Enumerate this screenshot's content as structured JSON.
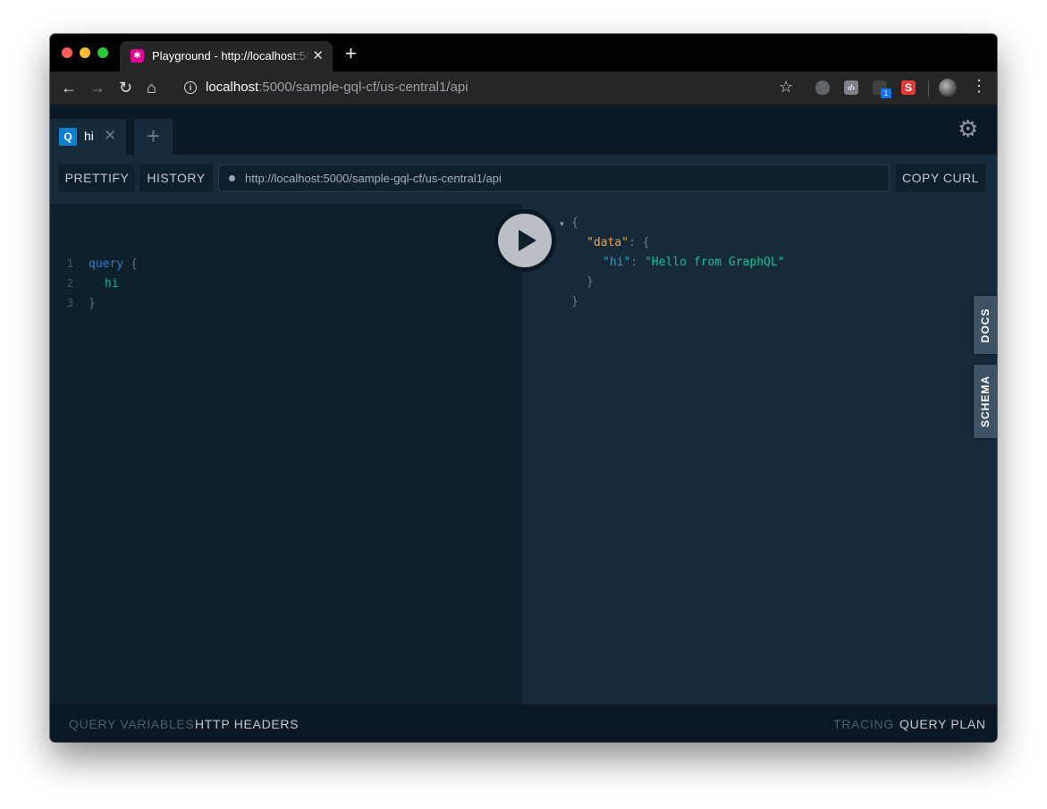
{
  "browser": {
    "tab_title": "Playground - http://localhost:5000/sample-gql-cf/us-central1/api",
    "tab_close": "✕",
    "new_tab": "+",
    "url_host": "localhost",
    "url_path": ":5000/sample-gql-cf/us-central1/api",
    "ext_s": "S",
    "ext_badge": "1"
  },
  "playground": {
    "query_tab": {
      "badge": "Q",
      "name": "hi",
      "close": "✕"
    },
    "add_tab": "+",
    "toolbar": {
      "prettify": "PRETTIFY",
      "history": "HISTORY",
      "endpoint": "http://localhost:5000/sample-gql-cf/us-central1/api",
      "copy_curl": "COPY CURL"
    },
    "editor": {
      "lines": [
        {
          "n": "1",
          "kw": "query",
          "rest": " {"
        },
        {
          "n": "2",
          "field": "hi"
        },
        {
          "n": "3",
          "brace": "}"
        }
      ]
    },
    "result": {
      "open": "{",
      "data_key": "\"data\"",
      "colon": ": ",
      "data_open": "{",
      "hi_key": "\"hi\"",
      "hi_value": "\"Hello from GraphQL\"",
      "data_close": "}",
      "close": "}"
    },
    "side_tabs": {
      "docs": "DOCS",
      "schema": "SCHEMA"
    },
    "bottom": {
      "query_variables": "QUERY VARIABLES",
      "http_headers": "HTTP HEADERS",
      "tracing": "TRACING",
      "query_plan": "QUERY PLAN"
    }
  }
}
